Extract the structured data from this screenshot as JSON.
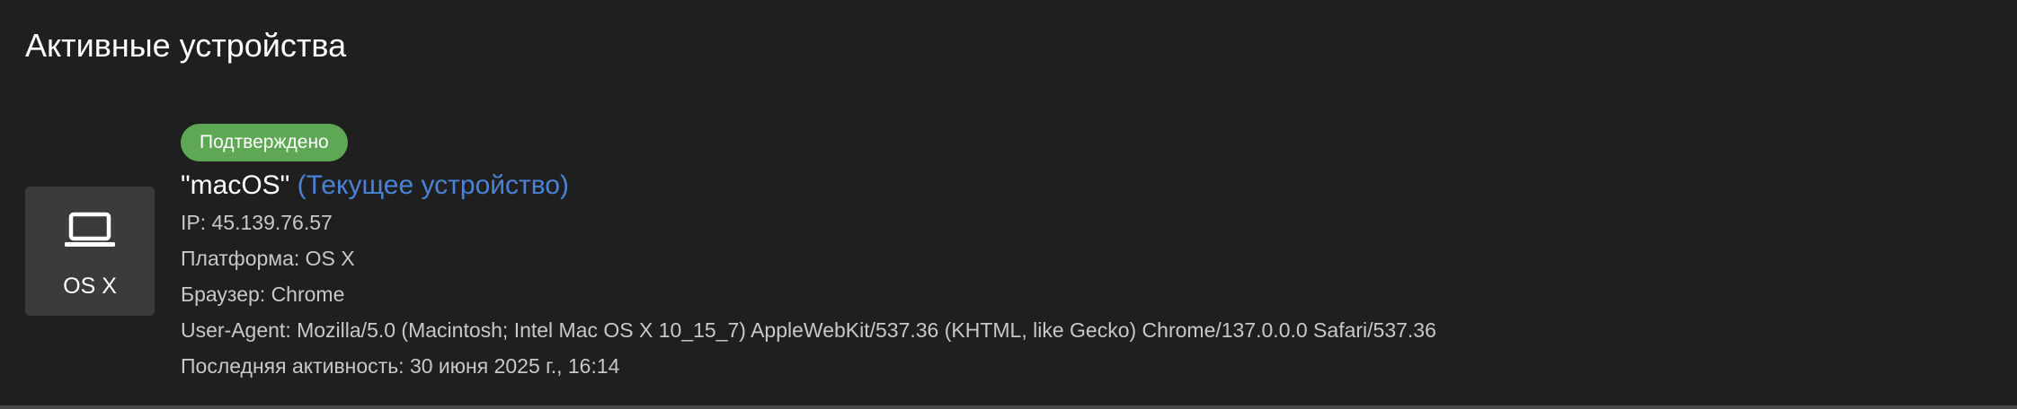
{
  "header": {
    "title": "Активные устройства"
  },
  "device": {
    "icon": "laptop-icon",
    "os_label": "OS X",
    "status_badge": "Подтверждено",
    "status_color": "#5ea855",
    "name": "\"macOS\"",
    "current_label": "(Текущее устройство)",
    "current_color": "#4a82d6",
    "ip_line": "IP: 45.139.76.57",
    "platform_line": "Платформа: OS X",
    "browser_line": "Браузер: Chrome",
    "user_agent_line": "User-Agent: Mozilla/5.0 (Macintosh; Intel Mac OS X 10_15_7) AppleWebKit/537.36 (KHTML, like Gecko) Chrome/137.0.0.0 Safari/537.36",
    "last_activity_line": "Последняя активность: 30 июня 2025 г., 16:14"
  }
}
